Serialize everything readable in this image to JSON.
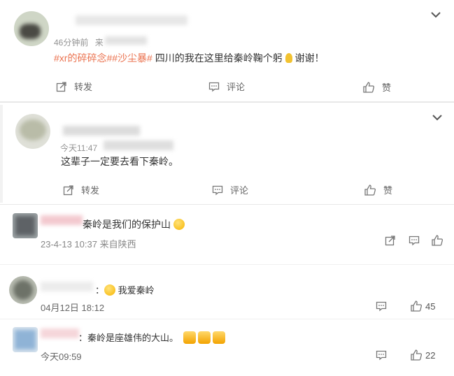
{
  "post1": {
    "time": "46分钟前",
    "source_partial": "来",
    "hashtags": "#xr的碎碎念##沙尘暴#",
    "text": " 四川的我在这里给秦岭鞠个躬",
    "text_end": "谢谢！",
    "repost": "转发",
    "comment": "评论",
    "like": "赞"
  },
  "post2": {
    "time": "今天11:47",
    "text": "这辈子一定要去看下秦岭。",
    "repost": "转发",
    "comment": "评论",
    "like": "赞"
  },
  "comments": [
    {
      "text": "秦岭是我们的保护山",
      "time": "23-4-13 10:37 来自陕西"
    },
    {
      "text": "我爱秦岭",
      "time": "04月12日 18:12",
      "likes": "45"
    },
    {
      "text": "秦岭是座雄伟的大山。",
      "time": "今天09:59",
      "likes": "22"
    }
  ]
}
